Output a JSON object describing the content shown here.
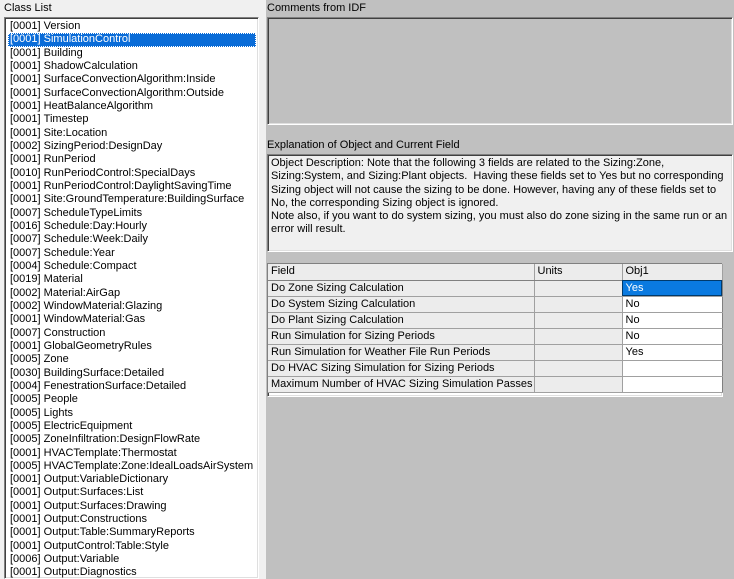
{
  "left": {
    "label": "Class List",
    "items": [
      {
        "count": "[0001]",
        "name": "Version",
        "selected": false
      },
      {
        "count": "[0001]",
        "name": "SimulationControl",
        "selected": true
      },
      {
        "count": "[0001]",
        "name": "Building",
        "selected": false
      },
      {
        "count": "[0001]",
        "name": "ShadowCalculation",
        "selected": false
      },
      {
        "count": "[0001]",
        "name": "SurfaceConvectionAlgorithm:Inside",
        "selected": false
      },
      {
        "count": "[0001]",
        "name": "SurfaceConvectionAlgorithm:Outside",
        "selected": false
      },
      {
        "count": "[0001]",
        "name": "HeatBalanceAlgorithm",
        "selected": false
      },
      {
        "count": "[0001]",
        "name": "Timestep",
        "selected": false
      },
      {
        "count": "[0001]",
        "name": "Site:Location",
        "selected": false
      },
      {
        "count": "[0002]",
        "name": "SizingPeriod:DesignDay",
        "selected": false
      },
      {
        "count": "[0001]",
        "name": "RunPeriod",
        "selected": false
      },
      {
        "count": "[0010]",
        "name": "RunPeriodControl:SpecialDays",
        "selected": false
      },
      {
        "count": "[0001]",
        "name": "RunPeriodControl:DaylightSavingTime",
        "selected": false
      },
      {
        "count": "[0001]",
        "name": "Site:GroundTemperature:BuildingSurface",
        "selected": false
      },
      {
        "count": "[0007]",
        "name": "ScheduleTypeLimits",
        "selected": false
      },
      {
        "count": "[0016]",
        "name": "Schedule:Day:Hourly",
        "selected": false
      },
      {
        "count": "[0007]",
        "name": "Schedule:Week:Daily",
        "selected": false
      },
      {
        "count": "[0007]",
        "name": "Schedule:Year",
        "selected": false
      },
      {
        "count": "[0004]",
        "name": "Schedule:Compact",
        "selected": false
      },
      {
        "count": "[0019]",
        "name": "Material",
        "selected": false
      },
      {
        "count": "[0002]",
        "name": "Material:AirGap",
        "selected": false
      },
      {
        "count": "[0002]",
        "name": "WindowMaterial:Glazing",
        "selected": false
      },
      {
        "count": "[0001]",
        "name": "WindowMaterial:Gas",
        "selected": false
      },
      {
        "count": "[0007]",
        "name": "Construction",
        "selected": false
      },
      {
        "count": "[0001]",
        "name": "GlobalGeometryRules",
        "selected": false
      },
      {
        "count": "[0005]",
        "name": "Zone",
        "selected": false
      },
      {
        "count": "[0030]",
        "name": "BuildingSurface:Detailed",
        "selected": false
      },
      {
        "count": "[0004]",
        "name": "FenestrationSurface:Detailed",
        "selected": false
      },
      {
        "count": "[0005]",
        "name": "People",
        "selected": false
      },
      {
        "count": "[0005]",
        "name": "Lights",
        "selected": false
      },
      {
        "count": "[0005]",
        "name": "ElectricEquipment",
        "selected": false
      },
      {
        "count": "[0005]",
        "name": "ZoneInfiltration:DesignFlowRate",
        "selected": false
      },
      {
        "count": "[0001]",
        "name": "HVACTemplate:Thermostat",
        "selected": false
      },
      {
        "count": "[0005]",
        "name": "HVACTemplate:Zone:IdealLoadsAirSystem",
        "selected": false
      },
      {
        "count": "[0001]",
        "name": "Output:VariableDictionary",
        "selected": false
      },
      {
        "count": "[0001]",
        "name": "Output:Surfaces:List",
        "selected": false
      },
      {
        "count": "[0001]",
        "name": "Output:Surfaces:Drawing",
        "selected": false
      },
      {
        "count": "[0001]",
        "name": "Output:Constructions",
        "selected": false
      },
      {
        "count": "[0001]",
        "name": "Output:Table:SummaryReports",
        "selected": false
      },
      {
        "count": "[0001]",
        "name": "OutputControl:Table:Style",
        "selected": false
      },
      {
        "count": "[0006]",
        "name": "Output:Variable",
        "selected": false
      },
      {
        "count": "[0001]",
        "name": "Output:Diagnostics",
        "selected": false
      }
    ]
  },
  "comments": {
    "label": "Comments from IDF",
    "value": ""
  },
  "explanation": {
    "label": "Explanation of Object and Current Field",
    "text": "Object Description: Note that the following 3 fields are related to the Sizing:Zone, Sizing:System, and Sizing:Plant objects.  Having these fields set to Yes but no corresponding Sizing object will not cause the sizing to be done. However, having any of these fields set to No, the corresponding Sizing object is ignored.\nNote also, if you want to do system sizing, you must also do zone sizing in the same run or an error will result."
  },
  "grid": {
    "columns": [
      "Field",
      "Units",
      "Obj1"
    ],
    "rows": [
      {
        "field": "Do Zone Sizing Calculation",
        "units": "",
        "obj1": "Yes",
        "selected": true
      },
      {
        "field": "Do System Sizing Calculation",
        "units": "",
        "obj1": "No",
        "selected": false
      },
      {
        "field": "Do Plant Sizing Calculation",
        "units": "",
        "obj1": "No",
        "selected": false
      },
      {
        "field": "Run Simulation for Sizing Periods",
        "units": "",
        "obj1": "No",
        "selected": false
      },
      {
        "field": "Run Simulation for Weather File Run Periods",
        "units": "",
        "obj1": "Yes",
        "selected": false
      },
      {
        "field": "Do HVAC Sizing Simulation for Sizing Periods",
        "units": "",
        "obj1": "",
        "selected": false
      },
      {
        "field": "Maximum Number of HVAC Sizing Simulation Passes",
        "units": "",
        "obj1": "",
        "selected": false
      }
    ]
  },
  "colors": {
    "selection_blue": "#0a6cd8",
    "cell_selection_blue": "#0a7ae0",
    "window_face": "#c0c0c0",
    "dialog_face": "#f0f0f0"
  }
}
